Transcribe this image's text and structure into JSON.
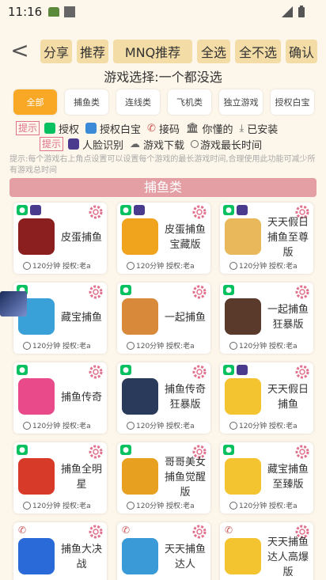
{
  "status": {
    "time": "11:16"
  },
  "toolbar": {
    "back": "<",
    "buttons": [
      "分享",
      "推荐",
      "MNQ推荐",
      "全选",
      "全不选",
      "确认"
    ]
  },
  "selection_text": "游戏选择:一个都没选",
  "categories": [
    "全部",
    "捕鱼类",
    "连线类",
    "飞机类",
    "独立游戏",
    "授权白宝"
  ],
  "legend": {
    "label1": "提示",
    "row1": [
      "授权",
      "授权白宝",
      "接码",
      "你懂的",
      "已安装"
    ],
    "label2": "提示",
    "row2": [
      "人脸识别",
      "游戏下载",
      "游戏最长时间"
    ],
    "hint": "提示:每个游戏右上角点设置可以设置每个游戏的最长游戏时间,合理使用此功能可减少所有游戏总时间"
  },
  "section_title": "捕鱼类",
  "games": [
    {
      "name": "皮蛋捕鱼",
      "meta": "120分钟 授权:老a",
      "badges": [
        "wx",
        "face"
      ],
      "color": "#8b1e1e"
    },
    {
      "name": "皮蛋捕鱼宝藏版",
      "meta": "120分钟 授权:老a",
      "badges": [
        "wx",
        "face"
      ],
      "color": "#f0a41e"
    },
    {
      "name": "天天假日捕鱼至尊版",
      "meta": "120分钟 授权:老a",
      "badges": [
        "wx",
        "face"
      ],
      "color": "#e9b85a"
    },
    {
      "name": "藏宝捕鱼",
      "meta": "120分钟 授权:老a",
      "badges": [
        "wx"
      ],
      "color": "#3aa0d8"
    },
    {
      "name": "一起捕鱼",
      "meta": "120分钟 授权:老a",
      "badges": [
        "wx"
      ],
      "color": "#d8893a"
    },
    {
      "name": "一起捕鱼狂暴版",
      "meta": "120分钟 授权:老a",
      "badges": [
        "wx"
      ],
      "color": "#5a3a2a"
    },
    {
      "name": "捕鱼传奇",
      "meta": "120分钟 授权:老a",
      "badges": [
        "wx"
      ],
      "color": "#e84a8a"
    },
    {
      "name": "捕鱼传奇狂暴版",
      "meta": "120分钟 授权:老a",
      "badges": [
        "wx"
      ],
      "color": "#2a3a5a"
    },
    {
      "name": "天天假日捕鱼",
      "meta": "120分钟 授权:老a",
      "badges": [
        "wx",
        "face"
      ],
      "color": "#f4c430"
    },
    {
      "name": "捕鱼全明星",
      "meta": "120分钟 授权:老a",
      "badges": [
        "wx"
      ],
      "color": "#d83a2a"
    },
    {
      "name": "哥哥美女捕鱼觉醒版",
      "meta": "120分钟 授权:老a",
      "badges": [
        "wx"
      ],
      "color": "#e8a020"
    },
    {
      "name": "藏宝捕鱼至臻版",
      "meta": "120分钟 授权:老a",
      "badges": [
        "wx"
      ],
      "color": "#f4c430"
    },
    {
      "name": "捕鱼大决战",
      "meta": "",
      "badges": [
        "code"
      ],
      "color": "#2a6ad8"
    },
    {
      "name": "天天捕鱼达人",
      "meta": "",
      "badges": [
        "code"
      ],
      "color": "#3a9ad8"
    },
    {
      "name": "天天捕鱼达人高爆版",
      "meta": "",
      "badges": [
        "code"
      ],
      "color": "#f4c430"
    }
  ],
  "colors": {
    "bg": "#fdf6ea",
    "button": "#f4dca6",
    "accent": "#f9a825",
    "section": "#e49fa5",
    "tip": "#e0728d"
  }
}
